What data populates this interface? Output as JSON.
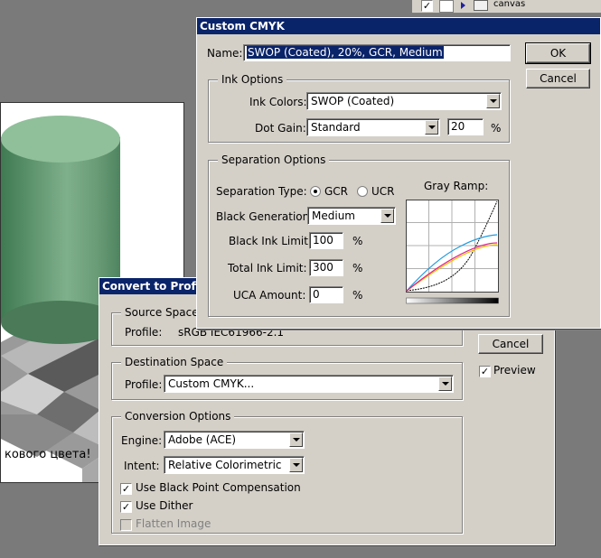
{
  "background": {
    "caption": "кового цвета!",
    "layers_label": "canvas"
  },
  "custom_cmyk": {
    "title": "Custom CMYK",
    "name_label": "Name:",
    "name_value": "SWOP (Coated), 20%, GCR, Medium",
    "ok_label": "OK",
    "cancel_label": "Cancel",
    "ink_options": {
      "legend": "Ink Options",
      "ink_colors_label": "Ink Colors:",
      "ink_colors_value": "SWOP (Coated)",
      "dot_gain_label": "Dot Gain:",
      "dot_gain_value": "Standard",
      "dot_gain_amount": "20",
      "percent": "%"
    },
    "separation_options": {
      "legend": "Separation Options",
      "type_label": "Separation Type:",
      "gcr_label": "GCR",
      "ucr_label": "UCR",
      "selected_type": "GCR",
      "black_gen_label": "Black Generation:",
      "black_gen_value": "Medium",
      "black_ink_label": "Black Ink Limit:",
      "black_ink_value": "100",
      "total_ink_label": "Total Ink Limit:",
      "total_ink_value": "300",
      "uca_label": "UCA Amount:",
      "uca_value": "0",
      "percent": "%",
      "gray_ramp_label": "Gray Ramp:"
    }
  },
  "convert_profile": {
    "title": "Convert to Profile",
    "source_space": {
      "legend": "Source Space",
      "profile_label": "Profile:",
      "profile_value": "sRGB IEC61966-2.1"
    },
    "destination_space": {
      "legend": "Destination Space",
      "profile_label": "Profile:",
      "profile_value": "Custom CMYK..."
    },
    "conversion_options": {
      "legend": "Conversion Options",
      "engine_label": "Engine:",
      "engine_value": "Adobe (ACE)",
      "intent_label": "Intent:",
      "intent_value": "Relative Colorimetric",
      "black_point_label": "Use Black Point Compensation",
      "black_point_checked": true,
      "dither_label": "Use Dither",
      "dither_checked": true,
      "flatten_label": "Flatten Image",
      "flatten_checked": false
    },
    "cancel_label": "Cancel",
    "preview_label": "Preview",
    "preview_checked": true
  },
  "colors": {
    "title_bar": "#0a246a",
    "dialog_face": "#d4d0c8",
    "cylinder_green": "#6fa07c",
    "ramp_cyan": "#1e9be0",
    "ramp_magenta": "#e0208c",
    "ramp_yellow": "#f0c000",
    "ramp_black": "#000000"
  }
}
